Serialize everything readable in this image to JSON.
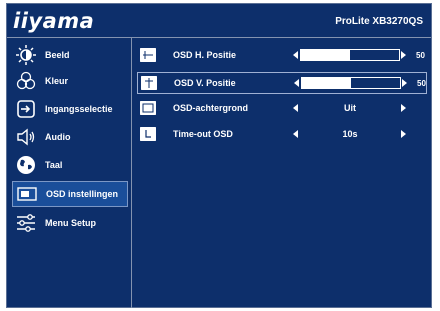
{
  "brand": {
    "logo": "iiyama",
    "model": "ProLite XB3270QS"
  },
  "sidebar": {
    "items": [
      {
        "label": "Beeld",
        "icon": "brightness-icon"
      },
      {
        "label": "Kleur",
        "icon": "color-palette-icon"
      },
      {
        "label": "Ingangsselectie",
        "icon": "input-select-icon"
      },
      {
        "label": "Audio",
        "icon": "speaker-icon"
      },
      {
        "label": "Taal",
        "icon": "globe-icon"
      },
      {
        "label": "OSD instellingen",
        "icon": "osd-icon",
        "active": true
      },
      {
        "label": "Menu Setup",
        "icon": "sliders-icon"
      }
    ]
  },
  "settings": {
    "rows": [
      {
        "label": "OSD H. Positie",
        "type": "slider",
        "value": 50,
        "max": 100,
        "icon": "horizontal-position-icon"
      },
      {
        "label": "OSD V. Positie",
        "type": "slider",
        "value": 50,
        "max": 100,
        "icon": "vertical-position-icon",
        "selected": true
      },
      {
        "label": "OSD-achtergrond",
        "type": "select",
        "value": "Uit",
        "icon": "background-icon"
      },
      {
        "label": "Time-out OSD",
        "type": "select",
        "value": "10s",
        "icon": "timeout-icon"
      }
    ]
  },
  "colors": {
    "background": "#0d2f6b",
    "active_item": "#1a4e9a",
    "text": "#ffffff"
  }
}
